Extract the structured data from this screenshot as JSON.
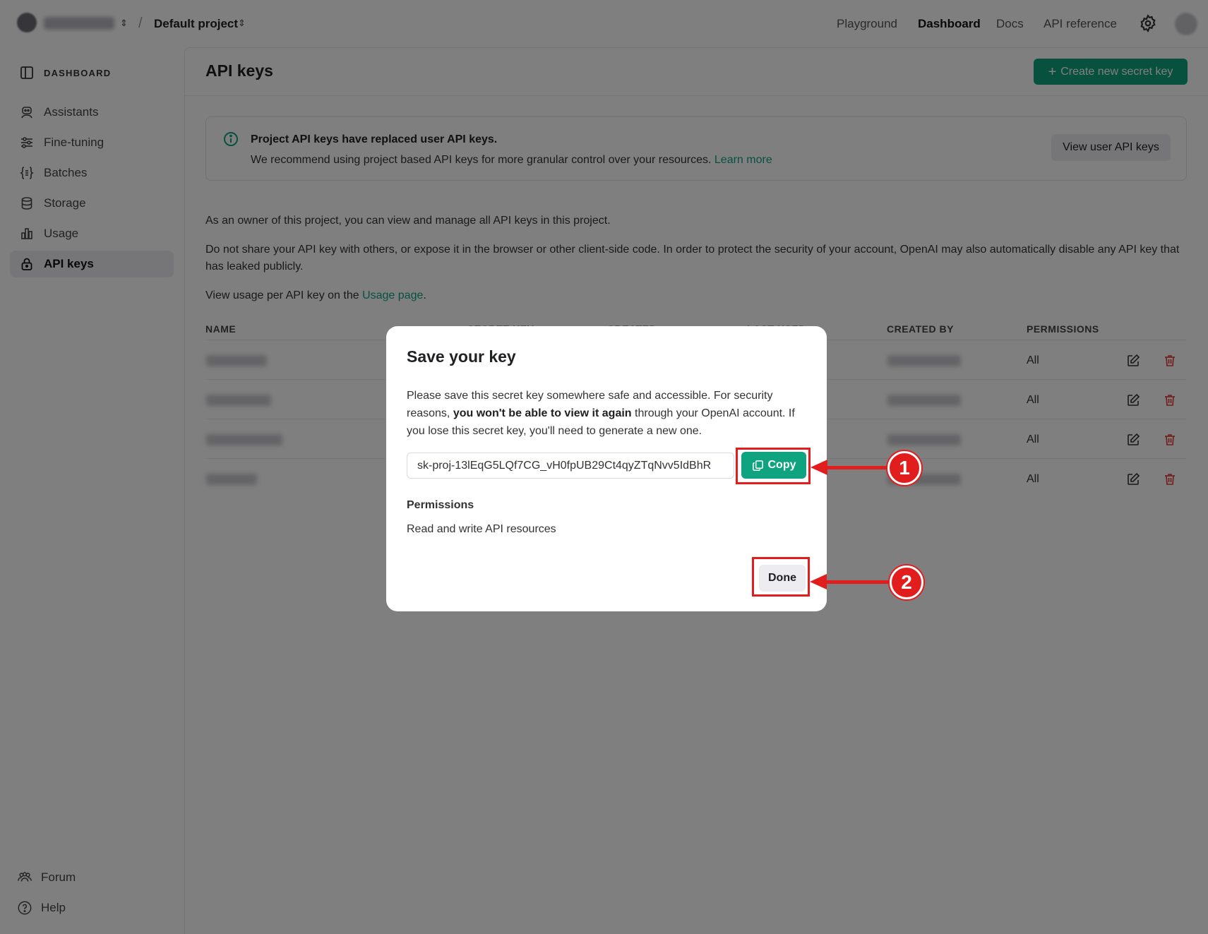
{
  "header": {
    "project_name": "Default project",
    "nav": [
      "Playground",
      "Dashboard",
      "Docs",
      "API reference"
    ],
    "active_nav": "Dashboard"
  },
  "sidebar": {
    "heading": "DASHBOARD",
    "items": [
      {
        "label": "Assistants",
        "icon": "assistant-icon"
      },
      {
        "label": "Fine-tuning",
        "icon": "sliders-icon"
      },
      {
        "label": "Batches",
        "icon": "batch-icon"
      },
      {
        "label": "Storage",
        "icon": "database-icon"
      },
      {
        "label": "Usage",
        "icon": "bar-chart-icon"
      },
      {
        "label": "API keys",
        "icon": "lock-icon",
        "active": true
      }
    ],
    "bottom": [
      {
        "label": "Forum",
        "icon": "people-icon"
      },
      {
        "label": "Help",
        "icon": "help-icon"
      }
    ]
  },
  "main": {
    "title": "API keys",
    "create_button": "Create new secret key",
    "notice": {
      "title": "Project API keys have replaced user API keys.",
      "body": "We recommend using project based API keys for more granular control over your resources.",
      "link": "Learn more",
      "button": "View user API keys"
    },
    "para1": "As an owner of this project, you can view and manage all API keys in this project.",
    "para2": "Do not share your API key with others, or expose it in the browser or other client-side code. In order to protect the security of your account, OpenAI may also automatically disable any API key that has leaked publicly.",
    "para3_prefix": "View usage per API key on the",
    "para3_link": "Usage page",
    "para3_suffix": ".",
    "table": {
      "columns": [
        "NAME",
        "SECRET KEY",
        "CREATED",
        "LAST USED",
        "CREATED BY",
        "PERMISSIONS"
      ],
      "rows": [
        {
          "permissions": "All"
        },
        {
          "permissions": "All"
        },
        {
          "permissions": "All"
        },
        {
          "permissions": "All"
        }
      ]
    }
  },
  "modal": {
    "title": "Save your key",
    "desc_prefix": "Please save this secret key somewhere safe and accessible. For security reasons,",
    "desc_bold": "you won't be able to view it again",
    "desc_suffix": "through your OpenAI account. If you lose this secret key, you'll need to generate a new one.",
    "secret_key": "sk-proj-13lEqG5LQf7CG_vH0fpUB29Ct4qyZTqNvv5IdBhR",
    "copy_label": "Copy",
    "permissions_label": "Permissions",
    "permissions_value": "Read and write API resources",
    "done_label": "Done"
  },
  "annotations": {
    "step1": "1",
    "step2": "2",
    "color": "#e11d1d"
  },
  "colors": {
    "accent": "#10a37f",
    "danger": "#e53935"
  }
}
